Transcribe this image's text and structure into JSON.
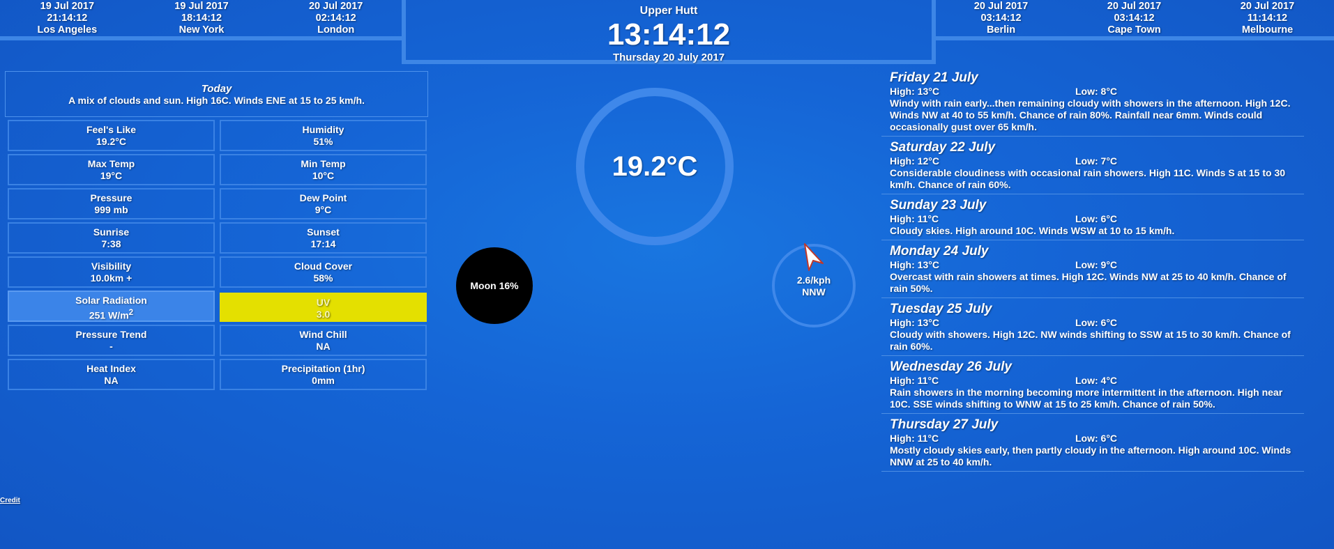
{
  "clocks_left": [
    {
      "date": "19 Jul 2017",
      "time": "21:14:12",
      "city": "Los Angeles"
    },
    {
      "date": "19 Jul 2017",
      "time": "18:14:12",
      "city": "New York"
    },
    {
      "date": "20 Jul 2017",
      "time": "02:14:12",
      "city": "London"
    }
  ],
  "main_clock": {
    "location": "Upper Hutt",
    "time": "13:14:12",
    "date": "Thursday 20 July 2017"
  },
  "clocks_right": [
    {
      "date": "20 Jul 2017",
      "time": "03:14:12",
      "city": "Berlin"
    },
    {
      "date": "20 Jul 2017",
      "time": "03:14:12",
      "city": "Cape Town"
    },
    {
      "date": "20 Jul 2017",
      "time": "11:14:12",
      "city": "Melbourne"
    }
  ],
  "today": {
    "title": "Today",
    "summary": "A mix of clouds and sun. High 16C. Winds ENE at 15 to 25 km/h."
  },
  "stats": {
    "feels_like": {
      "label": "Feel's Like",
      "value": "19.2°C"
    },
    "humidity": {
      "label": "Humidity",
      "value": "51%"
    },
    "max_temp": {
      "label": "Max Temp",
      "value": "19°C"
    },
    "min_temp": {
      "label": "Min Temp",
      "value": "10°C"
    },
    "pressure": {
      "label": "Pressure",
      "value": "999 mb"
    },
    "dew_point": {
      "label": "Dew Point",
      "value": "9°C"
    },
    "sunrise": {
      "label": "Sunrise",
      "value": "7:38"
    },
    "sunset": {
      "label": "Sunset",
      "value": "17:14"
    },
    "visibility": {
      "label": "Visibility",
      "value": "10.0km +"
    },
    "cloud_cover": {
      "label": "Cloud Cover",
      "value": "58%"
    },
    "solar_radiation": {
      "label": "Solar Radiation",
      "value": "251 W/m",
      "unit_sup": "2"
    },
    "uv": {
      "label": "UV",
      "value": "3.0"
    },
    "pressure_trend": {
      "label": "Pressure Trend",
      "value": "-"
    },
    "wind_chill": {
      "label": "Wind Chill",
      "value": "NA"
    },
    "heat_index": {
      "label": "Heat Index",
      "value": "NA"
    },
    "precipitation": {
      "label": "Precipitation (1hr)",
      "value": "0mm"
    }
  },
  "current_temp": "19.2°C",
  "moon": {
    "label": "Moon 16%",
    "illumination": 0.16
  },
  "wind": {
    "speed": "2.6/kph",
    "direction": "NNW",
    "bearing_deg": 337.5
  },
  "credit": "Credit",
  "forecast": [
    {
      "day": "Friday 21 July",
      "high": "High: 13°C",
      "low": "Low: 8°C",
      "desc": "Windy with rain early...then remaining cloudy with showers in the afternoon. High 12C. Winds NW at 40 to 55 km/h. Chance of rain 80%. Rainfall near 6mm. Winds could occasionally gust over 65 km/h."
    },
    {
      "day": "Saturday 22 July",
      "high": "High: 12°C",
      "low": "Low: 7°C",
      "desc": "Considerable cloudiness with occasional rain showers. High 11C. Winds S at 15 to 30 km/h. Chance of rain 60%."
    },
    {
      "day": "Sunday 23 July",
      "high": "High: 11°C",
      "low": "Low: 6°C",
      "desc": "Cloudy skies. High around 10C. Winds WSW at 10 to 15 km/h."
    },
    {
      "day": "Monday 24 July",
      "high": "High: 13°C",
      "low": "Low: 9°C",
      "desc": "Overcast with rain showers at times. High 12C. Winds NW at 25 to 40 km/h. Chance of rain 50%."
    },
    {
      "day": "Tuesday 25 July",
      "high": "High: 13°C",
      "low": "Low: 6°C",
      "desc": "Cloudy with showers. High 12C. NW winds shifting to SSW at 15 to 30 km/h. Chance of rain 60%."
    },
    {
      "day": "Wednesday 26 July",
      "high": "High: 11°C",
      "low": "Low: 4°C",
      "desc": "Rain showers in the morning becoming more intermittent in the afternoon. High near 10C. SSE winds shifting to WNW at 15 to 25 km/h. Chance of rain 50%."
    },
    {
      "day": "Thursday 27 July",
      "high": "High: 11°C",
      "low": "Low: 6°C",
      "desc": "Mostly cloudy skies early, then partly cloudy in the afternoon. High around 10C. Winds NNW at 25 to 40 km/h."
    }
  ],
  "colors": {
    "background": "#1565d6",
    "ring": "#3f88ea",
    "uv_highlight": "#e4e000",
    "wind_arrow": "#c0392b"
  }
}
